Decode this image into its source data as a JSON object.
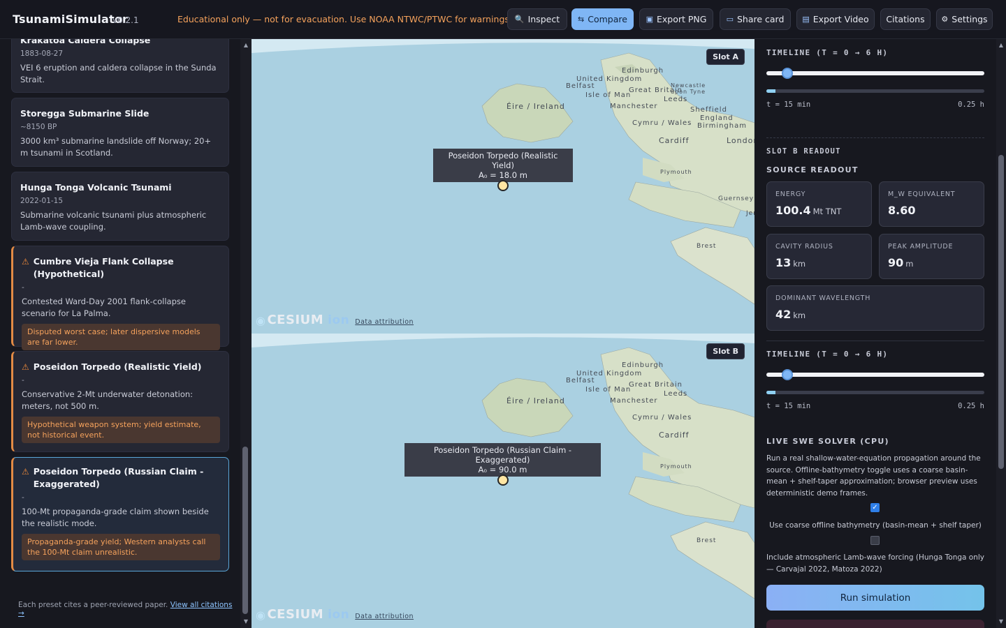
{
  "header": {
    "brand": "TsunamiSimulator",
    "version": "v0.2.1",
    "warning": "Educational only — not for evacuation. Use NOAA NTWC/PTWC for warnings.",
    "buttons": [
      {
        "label": "Inspect",
        "icon": "magnifier-icon",
        "glyph": "🔍"
      },
      {
        "label": "Compare",
        "icon": "swap-icon",
        "glyph": "⇆"
      },
      {
        "label": "Export PNG",
        "icon": "camera-icon",
        "glyph": "▣"
      },
      {
        "label": "Share card",
        "icon": "card-icon",
        "glyph": "▭"
      },
      {
        "label": "Export Video",
        "icon": "video-icon",
        "glyph": "▤"
      },
      {
        "label": "Citations",
        "icon": "",
        "glyph": ""
      },
      {
        "label": "Settings",
        "icon": "gear-icon",
        "glyph": "⚙"
      }
    ],
    "accent": "#7fb6f5",
    "warning_color": "#f5a25c"
  },
  "presets": [
    {
      "title": "Krakatoa Caldera Collapse",
      "date": "1883-08-27",
      "desc": "VEI 6 eruption and caldera collapse in the Sunda Strait."
    },
    {
      "title": "Storegga Submarine Slide",
      "date": "~8150 BP",
      "desc": "3000 km³ submarine landslide off Norway; 20+ m tsunami in Scotland."
    },
    {
      "title": "Hunga Tonga Volcanic Tsunami",
      "date": "2022-01-15",
      "desc": "Submarine volcanic tsunami plus atmospheric Lamb-wave coupling."
    },
    {
      "title": "Cumbre Vieja Flank Collapse (Hypothetical)",
      "date": "-",
      "desc": "Contested Ward-Day 2001 flank-collapse scenario for La Palma.",
      "note": "Disputed worst case; later dispersive models are far lower."
    },
    {
      "title": "Poseidon Torpedo (Realistic Yield)",
      "date": "-",
      "desc": "Conservative 2-Mt underwater detonation: meters, not 500 m.",
      "note": "Hypothetical weapon system; yield estimate, not historical event."
    },
    {
      "title": "Poseidon Torpedo (Russian Claim - Exaggerated)",
      "date": "-",
      "desc": "100-Mt propaganda-grade claim shown beside the realistic mode.",
      "note": "Propaganda-grade yield; Western analysts call the 100-Mt claim unrealistic."
    }
  ],
  "sidebar_footer": {
    "text": "Each preset cites a peer-reviewed paper.",
    "link": "View all citations →"
  },
  "maps": {
    "slot_a": {
      "tag": "Slot A",
      "tooltip_title": "Poseidon Torpedo (Realistic Yield)",
      "tooltip_sub": "A₀ = 18.0 m"
    },
    "slot_b": {
      "tag": "Slot B",
      "tooltip_title": "Poseidon Torpedo (Russian Claim - Exaggerated)",
      "tooltip_sub": "A₀ = 90.0 m"
    },
    "labels": [
      "Edinburgh",
      "United Kingdom",
      "Belfast",
      "Isle of Man",
      "Great Britain",
      "Newcastle upon Tyne",
      "Éire / Ireland",
      "Manchester",
      "Leeds",
      "Sheffield",
      "England",
      "Birmingham",
      "Cymru / Wales",
      "Cardiff",
      "London",
      "Plymouth",
      "Guernsey",
      "Brest",
      "Jersey"
    ],
    "cesium": "CESIUM",
    "ion": "ion",
    "attribution": "Data attribution"
  },
  "right": {
    "timeline_label": "TIMELINE (T = 0 → 6 H)",
    "t_label": "t = 15 min",
    "t_hours": "0.25 h",
    "timeline_fraction": 0.042,
    "slot_b_readout": "SLOT B READOUT",
    "source_readout": "SOURCE READOUT",
    "tiles": [
      {
        "label": "ENERGY",
        "value": "100.4",
        "unit": "Mt TNT"
      },
      {
        "label": "M_W EQUIVALENT",
        "value": "8.60",
        "unit": ""
      },
      {
        "label": "CAVITY RADIUS",
        "value": "13",
        "unit": "km"
      },
      {
        "label": "PEAK AMPLITUDE",
        "value": "90",
        "unit": "m"
      },
      {
        "label": "DOMINANT WAVELENGTH",
        "value": "42",
        "unit": "km"
      }
    ],
    "solver_title": "LIVE SWE SOLVER (CPU)",
    "solver_desc": "Run a real shallow-water-equation propagation around the source. Offline-bathymetry toggle uses a coarse basin-mean + shelf-taper approximation; browser preview uses deterministic demo frames.",
    "checkbox1_label": "Use coarse offline bathymetry (basin-mean + shelf taper)",
    "checkbox1_checked": true,
    "checkbox2_label": "Include atmospheric Lamb-wave forcing (Hunga Tonga only — Carvajal 2022, Matoza 2022)",
    "checkbox2_checked": false,
    "run_label": "Run simulation"
  }
}
